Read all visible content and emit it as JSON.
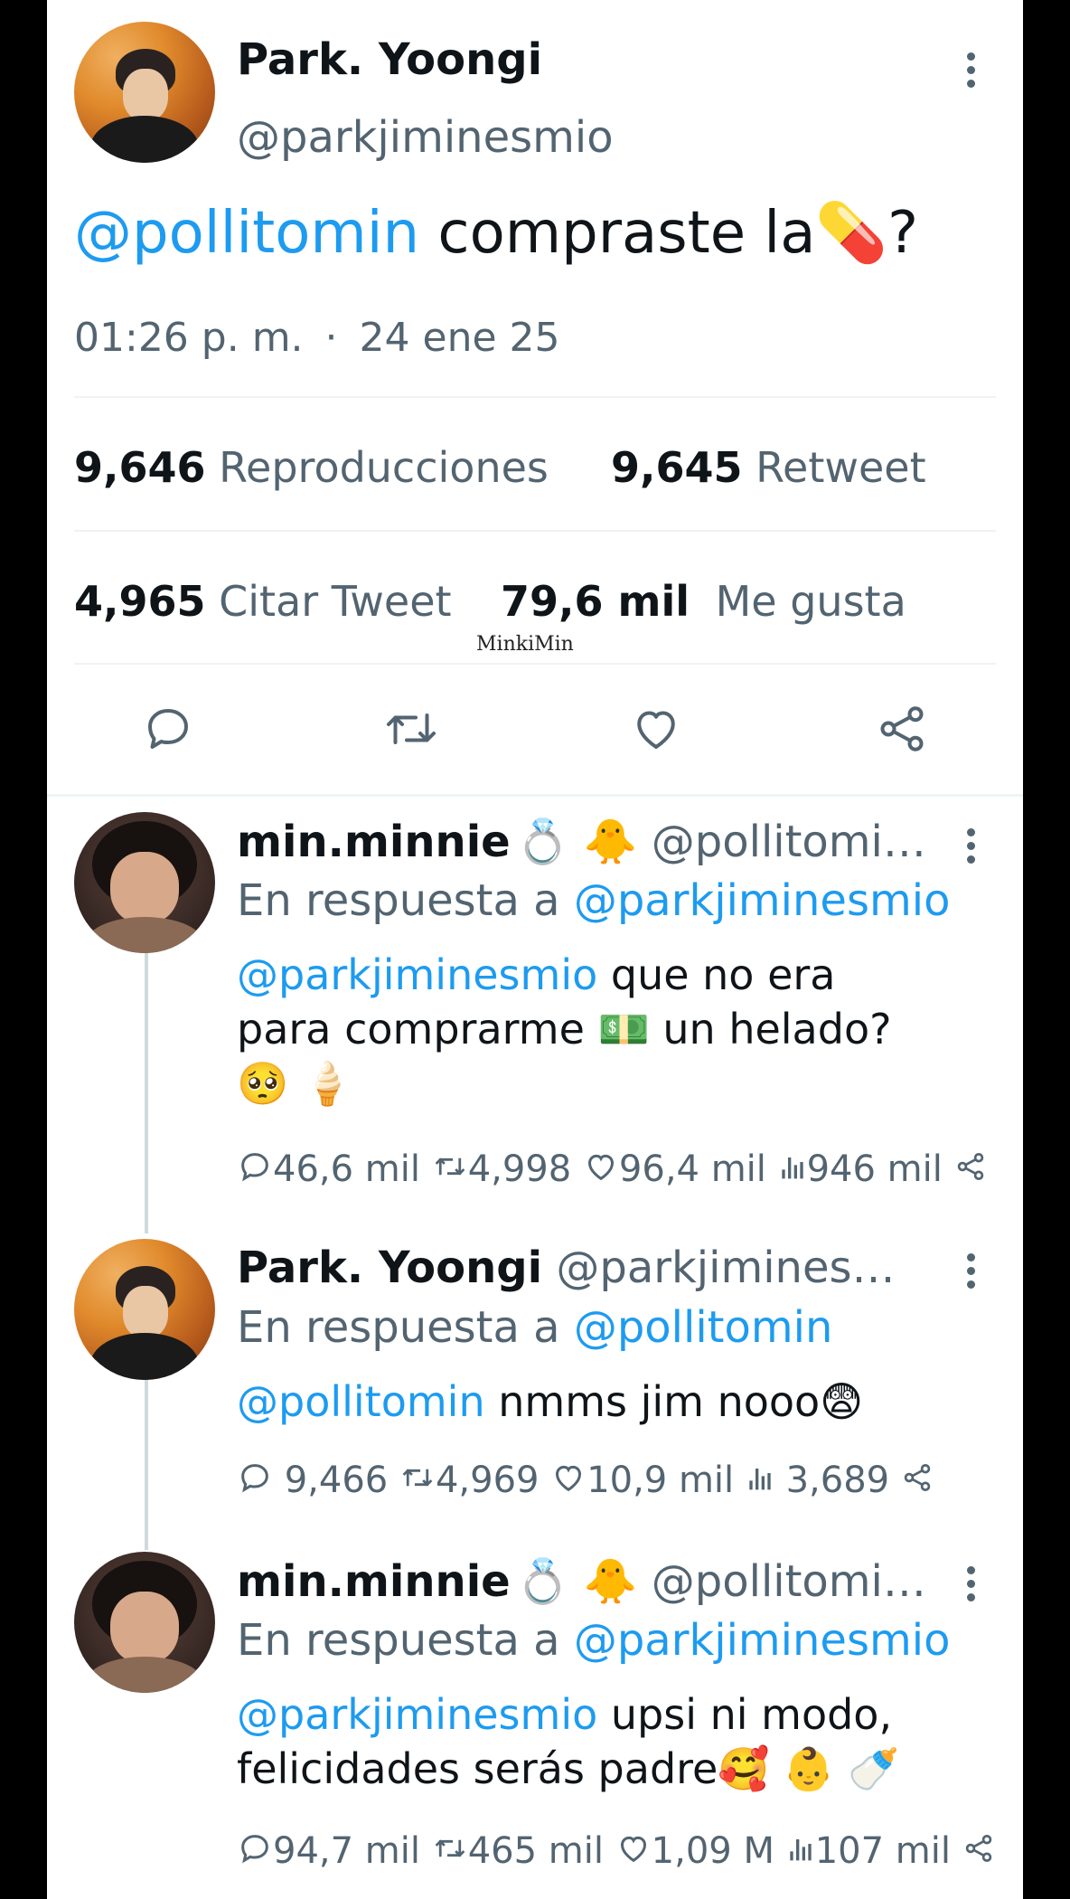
{
  "tweet": {
    "author_name": "Park. Yoongi",
    "author_handle": "@parkjiminesmio",
    "mention": "@pollitomin",
    "text": " compraste la",
    "emoji": "💊",
    "text_end": "?",
    "time": "01:26 p. m.",
    "dot": "·",
    "date": "24 ene 25",
    "stats": {
      "views_count": "9,646",
      "views_label": "Reproducciones",
      "retweets_count": "9,645",
      "retweets_label": "Retweet",
      "quotes_count": "4,965",
      "quotes_label": "Citar Tweet",
      "likes_count": "79,6 mil",
      "likes_label": "Me gusta"
    },
    "watermark": "MinkiMin",
    "actions": [
      "reply-icon",
      "retweet-icon",
      "like-icon",
      "share-icon"
    ]
  },
  "replies": [
    {
      "name": "min.minnie",
      "name_emoji": "💍 🐥",
      "handle": "@pollitomi…",
      "reply_prefix": "En respuesta a",
      "reply_to": "@parkjiminesmio",
      "mention": "@parkjiminesmio",
      "line1": " que no era",
      "line2": "para comprarme 💵 un helado?",
      "line3": "🥺 🍦",
      "reply_count": "46,6 mil",
      "retweet_count": "4,998",
      "like_count": "96,4 mil",
      "view_count": "946 mil"
    },
    {
      "name": "Park. Yoongi",
      "handle": "@parkjimines…",
      "reply_prefix": "En respuesta a",
      "reply_to": "@pollitomin",
      "mention": "@pollitomin",
      "line1": " nmms jim nooo😨",
      "reply_count": "9,466",
      "retweet_count": "4,969",
      "like_count": "10,9 mil",
      "view_count": "3,689"
    },
    {
      "name": "min.minnie",
      "name_emoji": "💍 🐥",
      "handle": "@pollitomi…",
      "reply_prefix": "En respuesta a",
      "reply_to": "@parkjiminesmio",
      "mention": "@parkjiminesmio",
      "line1": " upsi ni modo,",
      "line2": "felicidades serás padre🥰 👶 🍼",
      "reply_count": "94,7 mil",
      "retweet_count": "465 mil",
      "like_count": "1,09 M",
      "view_count": "107 mil"
    }
  ],
  "colors": {
    "link": "#1d9bf0",
    "muted": "#536471",
    "text": "#0f1419",
    "divider": "#eff3f4"
  }
}
